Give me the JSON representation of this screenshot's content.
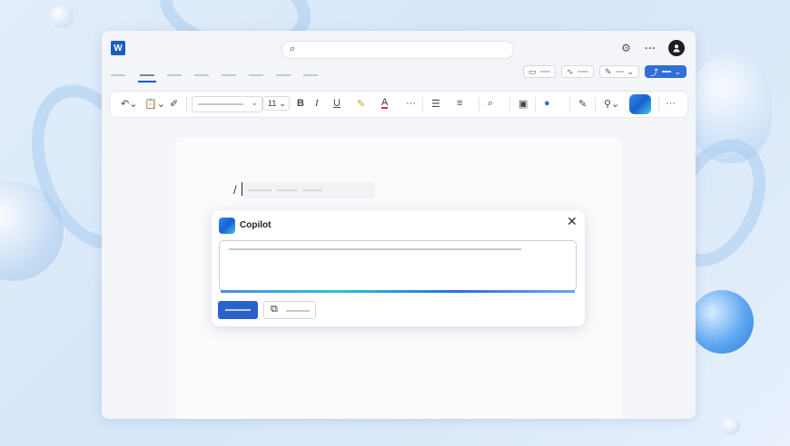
{
  "app": {
    "logo_letter": "W"
  },
  "titlebar": {
    "search_icon": "⌕",
    "settings_icon": "⚙",
    "more_icon": "···",
    "avatar_icon": "person-icon"
  },
  "ribbon": {
    "font_size": "11",
    "bold": "B",
    "italic": "I",
    "underline": "U",
    "highlight_icon": "✎",
    "font_color": "A",
    "more": "···",
    "list_icon": "☰",
    "align_icon": "≡",
    "find_icon": "⌕",
    "dictate_icon": "🎙",
    "overflow": "···"
  },
  "page": {
    "slash_text": "/"
  },
  "copilot": {
    "title": "Copilot",
    "close_icon": "✕",
    "reference_icon": "⧉"
  }
}
